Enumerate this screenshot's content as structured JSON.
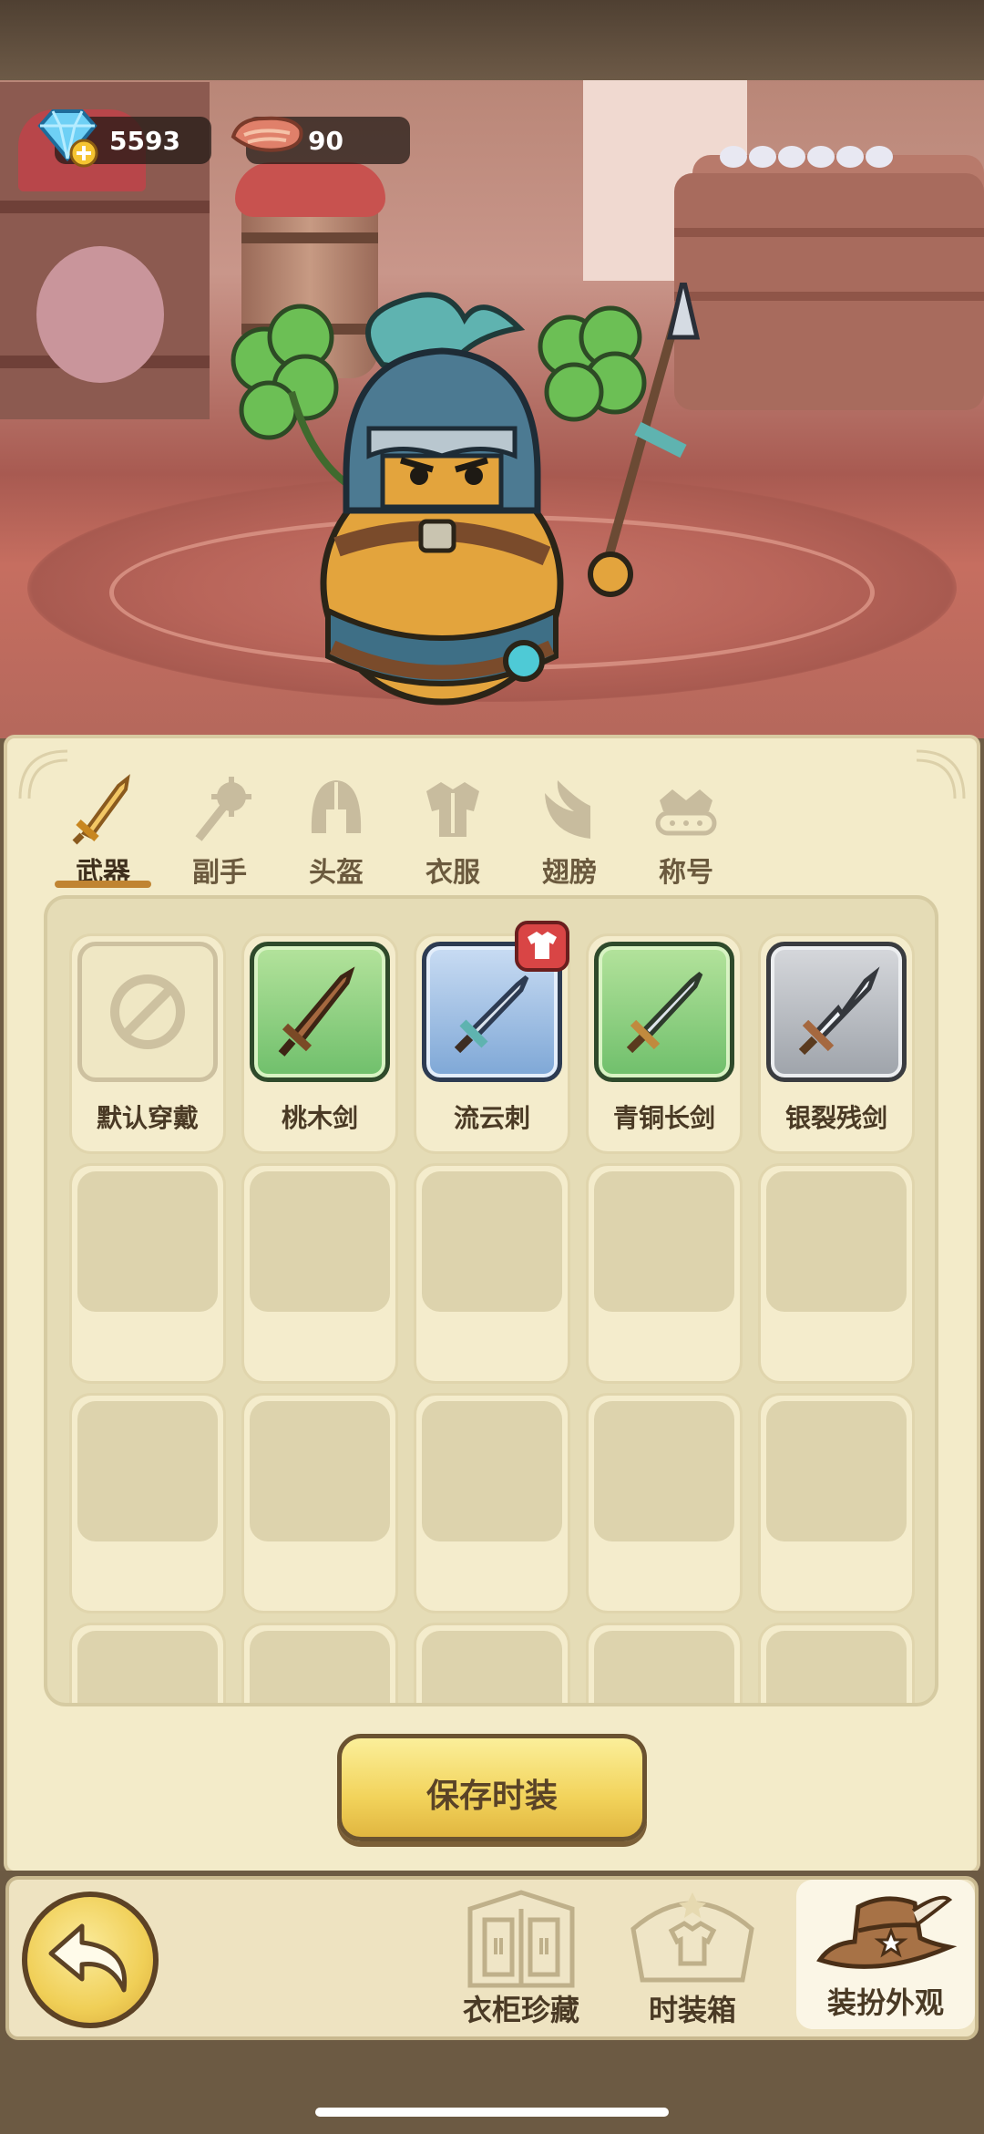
{
  "currency": {
    "gems": "5593",
    "meat": "90"
  },
  "tabs": [
    {
      "label": "武器",
      "icon": "sword-icon",
      "active": true
    },
    {
      "label": "副手",
      "icon": "mace-icon",
      "active": false
    },
    {
      "label": "头盔",
      "icon": "helmet-icon",
      "active": false
    },
    {
      "label": "衣服",
      "icon": "armor-icon",
      "active": false
    },
    {
      "label": "翅膀",
      "icon": "wing-icon",
      "active": false
    },
    {
      "label": "称号",
      "icon": "crown-icon",
      "active": false
    }
  ],
  "items": [
    {
      "name": "默认穿戴",
      "rarity": "default",
      "icon": "none-icon"
    },
    {
      "name": "桃木剑",
      "rarity": "green",
      "icon": "wooden-sword-icon"
    },
    {
      "name": "流云刺",
      "rarity": "blue",
      "icon": "spear-sword-icon",
      "badge": "shirt-badge-icon"
    },
    {
      "name": "青铜长剑",
      "rarity": "green",
      "icon": "bronze-sword-icon"
    },
    {
      "name": "银裂残剑",
      "rarity": "gray",
      "icon": "silver-sword-icon"
    }
  ],
  "save_button": "保存时装",
  "bottom_nav": {
    "collection": "衣柜珍藏",
    "box": "时装箱",
    "dressup": "装扮外观"
  },
  "colors": {
    "panel": "#f3ebc9",
    "accent": "#c08432",
    "button": "#f2d35b"
  }
}
